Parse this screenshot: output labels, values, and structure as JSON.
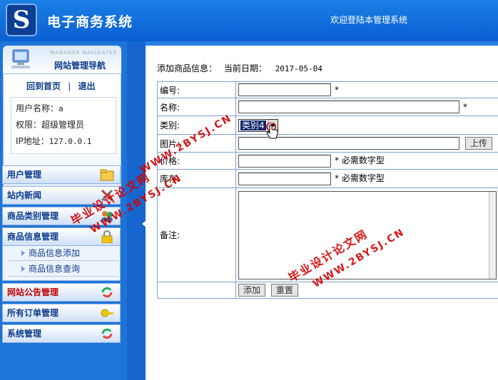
{
  "header": {
    "logo_letter": "S",
    "title": "电子商务系统",
    "welcome": "欢迎登陆本管理系统"
  },
  "sidebar": {
    "nav_sub": "MANAGER NAVIGATES",
    "nav_title": "网站管理导航",
    "home_link": "回到首页",
    "separator": "|",
    "logout_link": "退出",
    "user_label": "用户名称：",
    "user_value": "a",
    "role_label": "权限：",
    "role_value": "超级管理员",
    "ip_label": "IP地址：",
    "ip_value": "127.0.0.1",
    "menus": [
      {
        "label": "用户管理",
        "icon": "folder-icon"
      },
      {
        "label": "站内新闻",
        "icon": "tools-icon"
      },
      {
        "label": "商品类别管理",
        "icon": "users-icon"
      },
      {
        "label": "商品信息管理",
        "icon": "lock-icon"
      },
      {
        "label": "网站公告管理",
        "icon": "refresh-icon"
      },
      {
        "label": "所有订单管理",
        "icon": "key-icon"
      },
      {
        "label": "系统管理",
        "icon": "refresh-icon"
      }
    ],
    "subitems": [
      "商品信息添加",
      "商品信息查询"
    ]
  },
  "main": {
    "heading": "添加商品信息：",
    "date_label": "当前日期：",
    "date_value": "2017-05-04",
    "form": {
      "code_label": "编号:",
      "name_label": "名称:",
      "category_label": "类别:",
      "category_value": "类别4",
      "image_label": "图片:",
      "upload_button": "上传",
      "price_label": "价格:",
      "stock_label": "库存:",
      "remark_label": "备注:",
      "required_mark": "*",
      "number_hint": "* 必需数字型",
      "add_button": "添加",
      "reset_button": "重置"
    }
  },
  "watermarks": [
    "毕业设计论文网",
    "WWW.2BYSJ.CN"
  ],
  "colors": {
    "header_blue": "#0a5fd1",
    "accent_red": "#d40000",
    "menu_text": "#0d3b8c"
  }
}
